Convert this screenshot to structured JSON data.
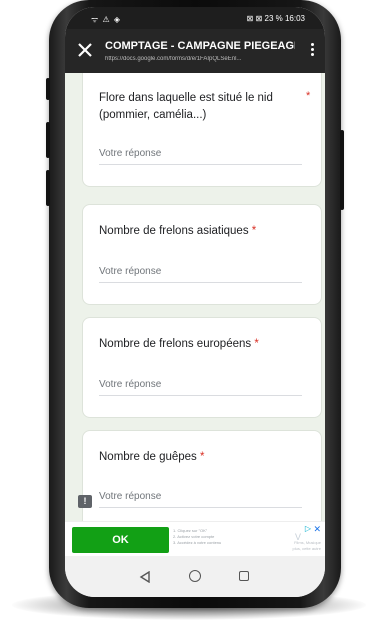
{
  "status_bar": {
    "left_icons": "ᯤ ⚠ ◈",
    "right_text": "⊠ ⊠ 23 % 16:03"
  },
  "toolbar": {
    "title": "COMPTAGE - CAMPAGNE PIEGEAGE...",
    "url": "https://docs.google.com/forms/d/e/1FAIpQLSeEnl..."
  },
  "form": {
    "questions": [
      {
        "title": "Flore dans laquelle est situé le nid",
        "title_cont": "(pommier, camélia...)",
        "required": "*",
        "placeholder": "Votre réponse"
      },
      {
        "title": "Nombre de frelons asiatiques",
        "required": "*",
        "placeholder": "Votre réponse"
      },
      {
        "title": "Nombre de frelons européens",
        "required": "*",
        "placeholder": "Votre réponse"
      },
      {
        "title": "Nombre de guêpes",
        "required": "*",
        "placeholder": "Votre réponse"
      }
    ]
  },
  "ad": {
    "button_label": "OK",
    "steps": [
      "1. Cliquez sur \"OK\"",
      "2. Activez votre compte",
      "3. Accédez à votre contenu"
    ],
    "brand": "V",
    "side_text": [
      "Films, Musique",
      "plus, cette autre"
    ],
    "close": "✕",
    "choices": "▷"
  },
  "icons": {
    "close": "close-icon",
    "menu": "more-vert-icon",
    "feedback": "feedback-icon",
    "back": "nav-back-icon",
    "home": "nav-home-icon",
    "recent": "nav-recent-icon"
  },
  "colors": {
    "toolbar": "#262626",
    "form_background": "#edf2ea",
    "required": "#d93025",
    "ad_button": "#12a015"
  }
}
